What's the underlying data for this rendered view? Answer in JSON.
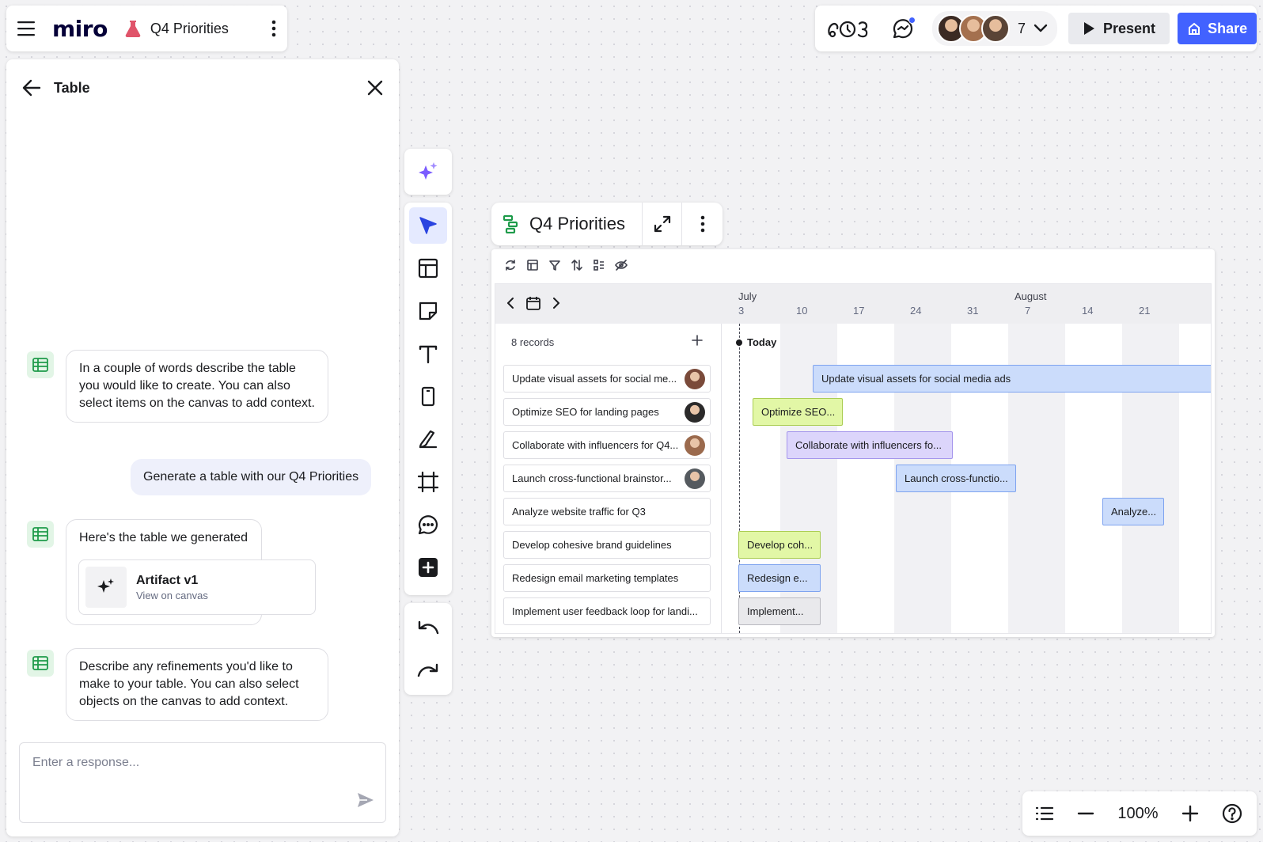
{
  "app": {
    "logo": "miro",
    "board_title": "Q4 Priorities"
  },
  "header_right": {
    "collaborator_count": "7",
    "present_label": "Present",
    "share_label": "Share",
    "avatar_colors": [
      "#3b2a23",
      "#a4704e",
      "#5a4436"
    ]
  },
  "panel": {
    "title": "Table",
    "messages": [
      {
        "from": "ai",
        "text": "In a couple of words describe the table you would like to create. You can also select items on the canvas to add context."
      },
      {
        "from": "user",
        "text": "Generate a table with our Q4 Priorities"
      },
      {
        "from": "ai",
        "text": "Here's the table we generated"
      },
      {
        "from": "ai",
        "text": "Describe any refinements you'd like to make to your table. You can also select objects on the canvas to add context."
      }
    ],
    "artifact": {
      "title": "Artifact v1",
      "subtitle": "View on canvas"
    },
    "response_placeholder": "Enter a response..."
  },
  "timeline": {
    "title": "Q4 Priorities",
    "records_label": "8 records",
    "today_label": "Today",
    "months": [
      "July",
      "August"
    ],
    "days": [
      "3",
      "10",
      "17",
      "24",
      "31",
      "7",
      "14",
      "21"
    ],
    "records": [
      {
        "name": "Update visual assets for social me...",
        "avatar": "#7a4a3a",
        "bar_label": "Update visual assets for social media ads",
        "bar_color": "#cbdcfb",
        "bar_border": "#7ea3ef"
      },
      {
        "name": "Optimize SEO for landing pages",
        "avatar": "#2b2a2a",
        "bar_label": "Optimize SEO...",
        "bar_color": "#e2f7a6",
        "bar_border": "#aacd52"
      },
      {
        "name": "Collaborate with influencers for Q4...",
        "avatar": "#9b6a4d",
        "bar_label": "Collaborate with influencers fo...",
        "bar_color": "#dcd5fb",
        "bar_border": "#a495ec"
      },
      {
        "name": "Launch cross-functional brainstor...",
        "avatar": "#555a5f",
        "bar_label": "Launch cross-functio...",
        "bar_color": "#cbdcfb",
        "bar_border": "#7ea3ef"
      },
      {
        "name": "Analyze website traffic for Q3",
        "avatar": "",
        "bar_label": "Analyze...",
        "bar_color": "#cbdcfb",
        "bar_border": "#7ea3ef"
      },
      {
        "name": "Develop cohesive brand guidelines",
        "avatar": "",
        "bar_label": "Develop coh...",
        "bar_color": "#e2f7a6",
        "bar_border": "#aacd52"
      },
      {
        "name": "Redesign email marketing templates",
        "avatar": "",
        "bar_label": "Redesign e...",
        "bar_color": "#cbdcfb",
        "bar_border": "#7ea3ef"
      },
      {
        "name": "Implement user feedback loop for landi...",
        "avatar": "",
        "bar_label": "Implement...",
        "bar_color": "#e9e9ec",
        "bar_border": "#b9b9c0"
      }
    ]
  },
  "zoom": {
    "level": "100%"
  },
  "colors": {
    "accent": "#4262ff",
    "ai_icon_bg": "#e2f5e6",
    "ai_icon_green": "#1e9b4a"
  },
  "icons": {
    "menu": "menu-icon",
    "flask": "flask-icon",
    "more": "more-vertical-icon",
    "reactions": "reactions-icon",
    "chat": "chat-icon",
    "present": "play-icon",
    "share": "share-board-icon",
    "tools": [
      "sparkle-icon",
      "cursor-icon",
      "template-icon",
      "sticky-note-icon",
      "text-icon",
      "device-frame-icon",
      "pen-icon",
      "frame-icon",
      "comment-icon",
      "add-plus-icon",
      "undo-icon",
      "redo-icon"
    ]
  }
}
